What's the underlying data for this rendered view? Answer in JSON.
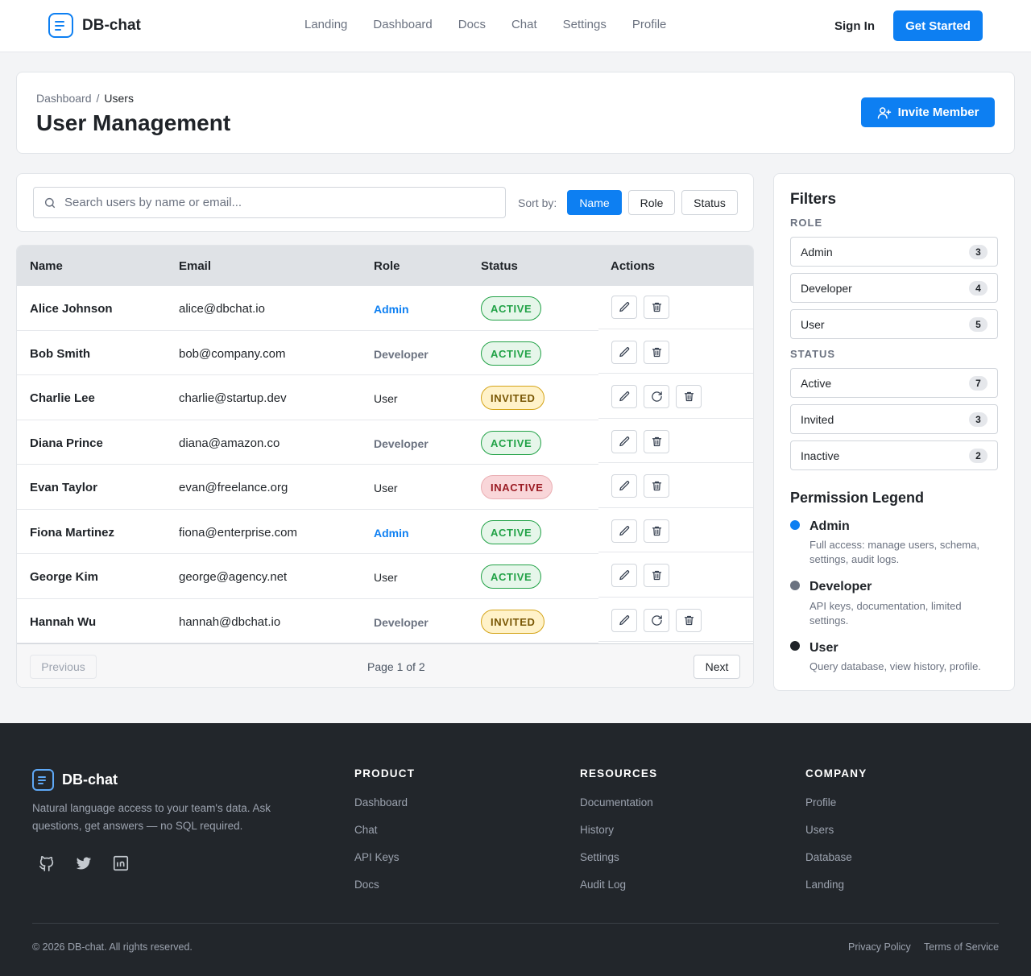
{
  "nav": {
    "brand": "DB-chat",
    "links": [
      "Landing",
      "Dashboard",
      "Docs",
      "Chat",
      "Settings",
      "Profile"
    ],
    "sign_in": "Sign In",
    "get_started": "Get Started"
  },
  "header": {
    "breadcrumb": [
      "Dashboard",
      "/",
      "Users"
    ],
    "title": "User Management",
    "invite_button": "Invite Member"
  },
  "search": {
    "placeholder": "Search users by name or email...",
    "value": "",
    "sort_label": "Sort by:",
    "sort_options": [
      "Name",
      "Role",
      "Status"
    ],
    "sort_active": "Name"
  },
  "table": {
    "columns": [
      "Name",
      "Email",
      "Role",
      "Status",
      "Actions"
    ],
    "rows": [
      {
        "name": "Alice Johnson",
        "email": "alice@dbchat.io",
        "role": "Admin",
        "status": "ACTIVE"
      },
      {
        "name": "Bob Smith",
        "email": "bob@company.com",
        "role": "Developer",
        "status": "ACTIVE"
      },
      {
        "name": "Charlie Lee",
        "email": "charlie@startup.dev",
        "role": "User",
        "status": "INVITED"
      },
      {
        "name": "Diana Prince",
        "email": "diana@amazon.co",
        "role": "Developer",
        "status": "ACTIVE"
      },
      {
        "name": "Evan Taylor",
        "email": "evan@freelance.org",
        "role": "User",
        "status": "INACTIVE"
      },
      {
        "name": "Fiona Martinez",
        "email": "fiona@enterprise.com",
        "role": "Admin",
        "status": "ACTIVE"
      },
      {
        "name": "George Kim",
        "email": "george@agency.net",
        "role": "User",
        "status": "ACTIVE"
      },
      {
        "name": "Hannah Wu",
        "email": "hannah@dbchat.io",
        "role": "Developer",
        "status": "INVITED"
      }
    ],
    "pagination": {
      "previous": "Previous",
      "info": "Page 1 of 2",
      "next": "Next"
    }
  },
  "filters": {
    "title": "Filters",
    "role_heading": "ROLE",
    "roles": [
      {
        "label": "Admin",
        "count": "3"
      },
      {
        "label": "Developer",
        "count": "4"
      },
      {
        "label": "User",
        "count": "5"
      }
    ],
    "status_heading": "STATUS",
    "statuses": [
      {
        "label": "Active",
        "count": "7"
      },
      {
        "label": "Invited",
        "count": "3"
      },
      {
        "label": "Inactive",
        "count": "2"
      }
    ],
    "legend_title": "Permission Legend",
    "legend": [
      {
        "name": "Admin",
        "desc": "Full access: manage users, schema, settings, audit logs.",
        "color": "#0d7ff2"
      },
      {
        "name": "Developer",
        "desc": "API keys, documentation, limited settings.",
        "color": "#6b7280"
      },
      {
        "name": "User",
        "desc": "Query database, view history, profile.",
        "color": "#1f2328"
      }
    ]
  },
  "footer": {
    "brand": "DB-chat",
    "description": "Natural language access to your team's data. Ask questions, get answers — no SQL required.",
    "social_icons": [
      "github-icon",
      "twitter-icon",
      "linkedin-icon"
    ],
    "columns": [
      {
        "title": "PRODUCT",
        "links": [
          "Dashboard",
          "Chat",
          "API Keys",
          "Docs"
        ]
      },
      {
        "title": "RESOURCES",
        "links": [
          "Documentation",
          "History",
          "Settings",
          "Audit Log"
        ]
      },
      {
        "title": "COMPANY",
        "links": [
          "Profile",
          "Users",
          "Database",
          "Landing"
        ]
      }
    ],
    "copyright": "© 2026 DB-chat. All rights reserved.",
    "legal": [
      "Privacy Policy",
      "Terms of Service"
    ]
  },
  "colors": {
    "accent": "#0d7ff2",
    "footer_bg": "#22262b",
    "active": "#22a247",
    "invited": "#d4a419",
    "inactive": "#9b1c24"
  }
}
